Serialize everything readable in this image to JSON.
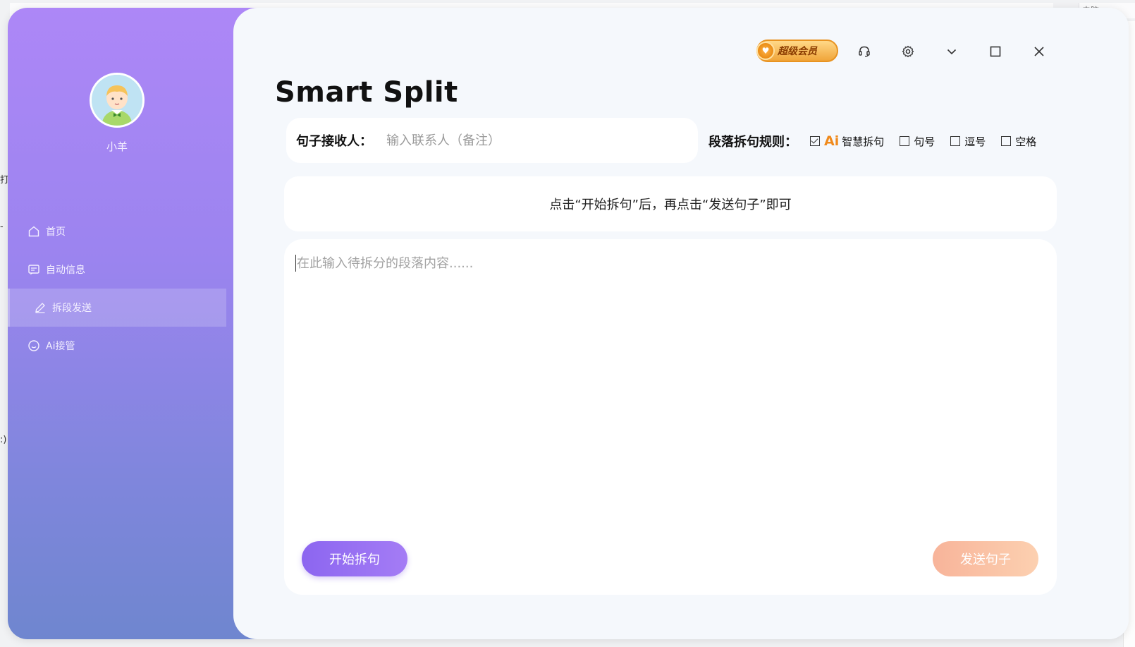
{
  "sidebar": {
    "username": "小羊",
    "items": [
      {
        "label": "首页",
        "icon": "home-icon"
      },
      {
        "label": "自动信息",
        "icon": "message-icon"
      },
      {
        "label": "拆段发送",
        "icon": "edit-icon",
        "active": true
      },
      {
        "label": "Ai接管",
        "icon": "smile-icon"
      }
    ]
  },
  "header": {
    "title": "Smart Split",
    "vip_label": "超级会员"
  },
  "receiver": {
    "label": "句子接收人：",
    "placeholder": "输入联系人（备注）"
  },
  "rules": {
    "label": "段落拆句规则：",
    "ai_tag": "Ai",
    "options": [
      {
        "label": "智慧拆句",
        "checked": true
      },
      {
        "label": "句号",
        "checked": false
      },
      {
        "label": "逗号",
        "checked": false
      },
      {
        "label": "空格",
        "checked": false
      }
    ]
  },
  "hint": "点击“开始拆句”后，再点击“发送句子”即可",
  "editor": {
    "placeholder": "在此输入待拆分的段落内容......"
  },
  "buttons": {
    "start": "开始拆句",
    "send": "发送句子"
  },
  "background": {
    "right_tab": "电脑",
    "left_glyphs": [
      "打",
      "-",
      ":)"
    ]
  },
  "colors": {
    "sidebar_top": "#ad87f7",
    "sidebar_bottom": "#6f86cf",
    "start_button": "#8c66f0",
    "send_button": "#f8b49a",
    "ai_accent": "#f08a1c"
  }
}
